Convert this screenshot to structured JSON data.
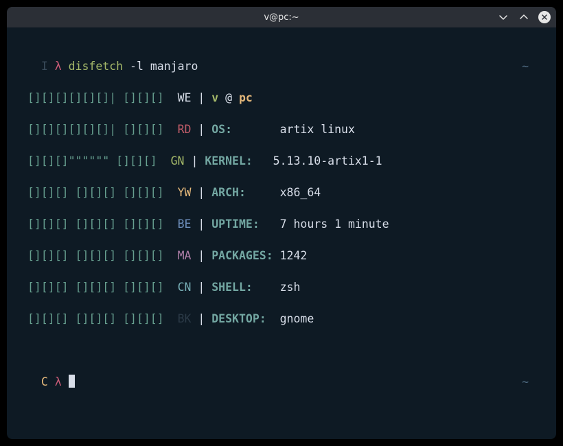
{
  "window": {
    "title": "v@pc:~"
  },
  "prompt1": {
    "lineNo": "I",
    "lambda": "λ",
    "command": "disfetch",
    "args": "-l manjaro",
    "tilde": "~"
  },
  "logo": [
    "[][][][][][]| [][][]",
    "[][][][][][]| [][][]",
    "[][][]\"\"\"\"\"\" [][][]",
    "[][][] [][][] [][][]",
    "[][][] [][][] [][][]",
    "[][][] [][][] [][][]",
    "[][][] [][][] [][][]",
    "[][][] [][][] [][][]"
  ],
  "colorLabels": [
    "WE",
    "RD",
    "GN",
    "YW",
    "BE",
    "MA",
    "CN",
    "BK"
  ],
  "pipe": "|",
  "info": {
    "user": "v",
    "at": "@",
    "host": "pc",
    "rows": [
      {
        "label": "OS:",
        "value": "artix linux"
      },
      {
        "label": "KERNEL:",
        "value": "5.13.10-artix1-1"
      },
      {
        "label": "ARCH:",
        "value": "x86_64"
      },
      {
        "label": "UPTIME:",
        "value": "7 hours 1 minute"
      },
      {
        "label": "PACKAGES:",
        "value": "1242"
      },
      {
        "label": "SHELL:",
        "value": "zsh"
      },
      {
        "label": "DESKTOP:",
        "value": "gnome"
      }
    ]
  },
  "prompt2": {
    "lineNo": "C",
    "lambda": "λ",
    "tilde": "~"
  }
}
